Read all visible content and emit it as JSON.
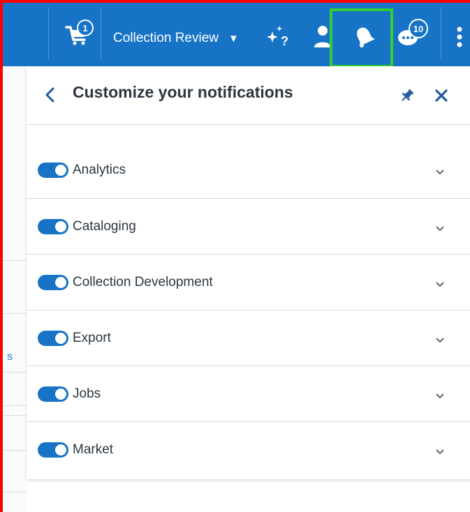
{
  "topbar": {
    "cart_badge": "1",
    "collection_label": "Collection Review",
    "collection_dropdown_glyph": "▼",
    "help_icon": "sparkle-question-icon",
    "user_icon": "user-icon",
    "bell_icon": "bell-icon",
    "chat_badge": "10",
    "more_icon": "more-vertical-icon",
    "colors": {
      "bar": "#1673c5",
      "highlight": "#33cc33",
      "frame": "#ff0000"
    }
  },
  "background": {
    "fragment_text": "s"
  },
  "panel": {
    "title": "Customize your notifications",
    "back_icon": "chevron-left-icon",
    "pin_icon": "pin-icon",
    "close_icon": "close-icon",
    "categories": [
      {
        "label": "Analytics",
        "enabled": true
      },
      {
        "label": "Cataloging",
        "enabled": true
      },
      {
        "label": "Collection Development",
        "enabled": true
      },
      {
        "label": "Export",
        "enabled": true
      },
      {
        "label": "Jobs",
        "enabled": true
      },
      {
        "label": "Market",
        "enabled": true
      }
    ],
    "toggle_color": "#1673c5"
  }
}
